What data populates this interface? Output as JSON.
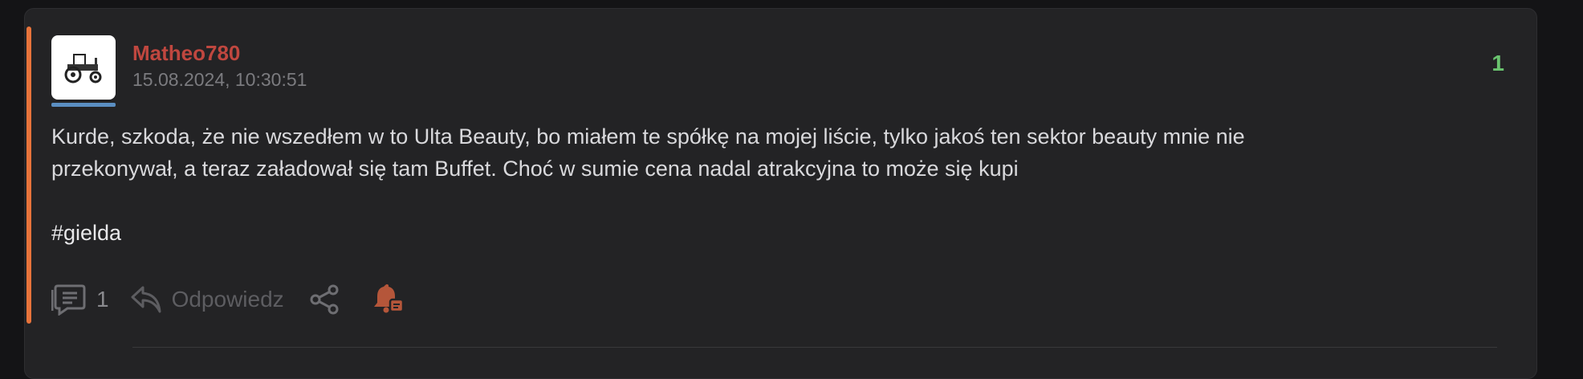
{
  "post": {
    "author": "Matheo780",
    "timestamp": "15.08.2024, 10:30:51",
    "vote_count": "1",
    "body_line_1": "Kurde, szkoda, że nie wszedłem w to Ulta Beauty, bo miałem te spółkę na mojej liście, tylko jakoś ten sektor beauty mnie nie",
    "body_line_2": "przekonywał, a teraz załadował się tam Buffet. Choć w sumie cena nadal atrakcyjna to może się kupi",
    "tag": "#gielda"
  },
  "actions": {
    "comment_count": "1",
    "reply_label": "Odpowiedz"
  },
  "icons": {
    "avatar": "tractor-icon",
    "comments": "comment-icon",
    "reply": "reply-icon",
    "share": "share-icon",
    "notify": "bell-icon"
  },
  "colors": {
    "accent": "#e8743b",
    "username": "#c0473f",
    "vote": "#6ac46f",
    "avatar_underline": "#5b8fc2"
  }
}
